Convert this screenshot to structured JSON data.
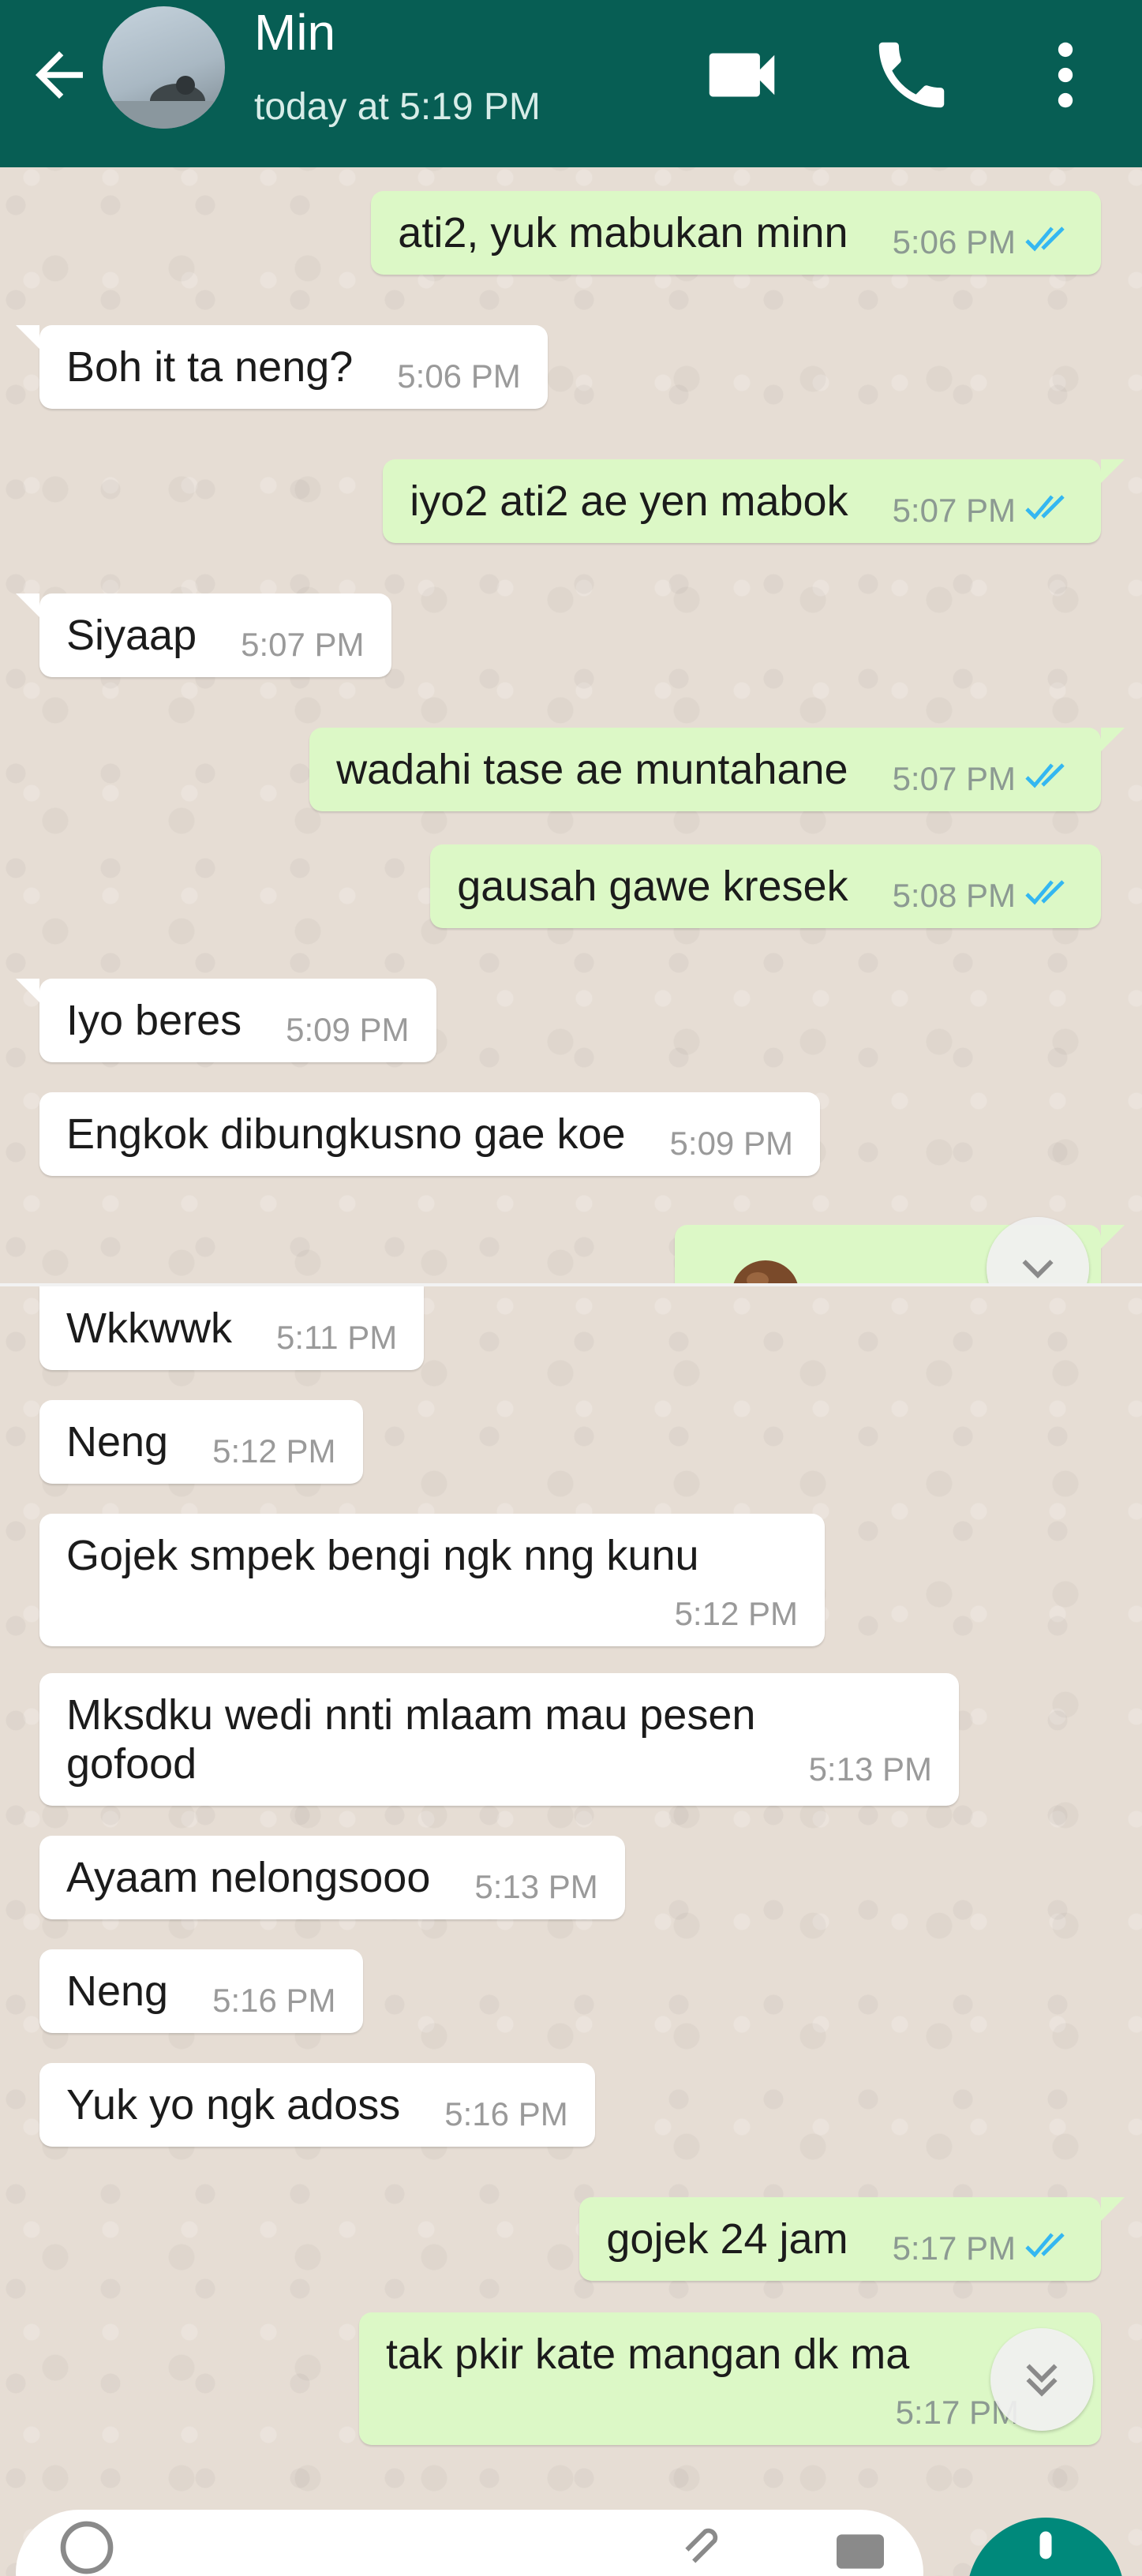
{
  "header": {
    "contact_name": "Min",
    "last_seen": "today at 5:19 PM",
    "color": "#075e54"
  },
  "icons": [
    "back-arrow-icon",
    "avatar",
    "video-call-icon",
    "phone-icon",
    "more-vert-icon",
    "double-check-icon",
    "scroll-down-icon",
    "emoji-icon",
    "attach-icon",
    "camera-icon",
    "mic-icon"
  ],
  "messages_top": [
    {
      "dir": "out",
      "text": "ati2, yuk mabukan minn",
      "time": "5:06 PM"
    },
    {
      "dir": "in",
      "text": "Boh it ta neng?",
      "time": "5:06 PM"
    },
    {
      "dir": "out",
      "text": "iyo2 ati2 ae yen mabok",
      "time": "5:07 PM"
    },
    {
      "dir": "in",
      "text": "Siyaap",
      "time": "5:07 PM"
    },
    {
      "dir": "out",
      "text": "wadahi tase ae muntahane",
      "time": "5:07 PM"
    },
    {
      "dir": "out",
      "text": "gausah gawe kresek",
      "time": "5:08 PM"
    },
    {
      "dir": "in",
      "text": "Iyo beres",
      "time": "5:09 PM"
    },
    {
      "dir": "in",
      "text": "Engkok dibungkusno gae koe",
      "time": "5:09 PM"
    }
  ],
  "messages_bottom": [
    {
      "dir": "in",
      "text": "Wkkwwk",
      "time": "5:11 PM"
    },
    {
      "dir": "in",
      "text": "Neng",
      "time": "5:12 PM"
    },
    {
      "dir": "in",
      "text": "Gojek smpek bengi ngk nng kunu",
      "time": "5:12 PM"
    },
    {
      "dir": "in",
      "text_line1": "Mksdku wedi nnti mlaam mau pesen",
      "text_line2": "gofood",
      "time": "5:13 PM"
    },
    {
      "dir": "in",
      "text": "Ayaam nelongsooo",
      "time": "5:13 PM"
    },
    {
      "dir": "in",
      "text": "Neng",
      "time": "5:16 PM"
    },
    {
      "dir": "in",
      "text": "Yuk yo ngk adoss",
      "time": "5:16 PM"
    },
    {
      "dir": "out",
      "text": "gojek 24 jam",
      "time": "5:17 PM"
    },
    {
      "dir": "out",
      "text": "tak pkir kate mangan dk ma",
      "time": "5:17 PM"
    }
  ],
  "colors": {
    "outgoing_bubble": "#dcf8c6",
    "incoming_bubble": "#ffffff",
    "read_ticks": "#34b7f1",
    "mic_button": "#00897b"
  }
}
